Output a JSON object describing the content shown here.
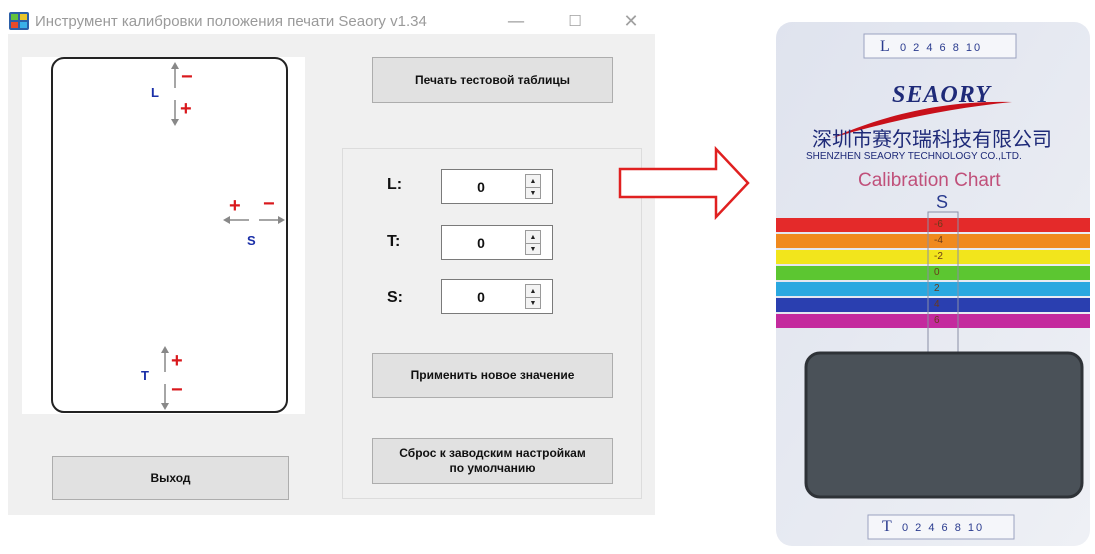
{
  "window": {
    "title": "Инструмент калибровки положения печати Seaory v1.34",
    "controls": {
      "minimize": "—",
      "maximize": "☐",
      "close": "✕"
    }
  },
  "diagram": {
    "label_l": "L",
    "label_s": "S",
    "label_t": "T",
    "plus": "+",
    "minus": "−",
    "accent_red": "#d9181c",
    "label_blue": "#1a2fa8"
  },
  "buttons": {
    "print_test": "Печать тестовой таблицы",
    "apply": "Применить новое значение",
    "reset_line1": "Сброс к заводским настройкам",
    "reset_line2": "по умолчанию",
    "exit": "Выход"
  },
  "fields": [
    {
      "label": "L:",
      "value": "0"
    },
    {
      "label": "T:",
      "value": "0"
    },
    {
      "label": "S:",
      "value": "0"
    }
  ],
  "card_photo": {
    "top_scale_letter": "L",
    "top_scale_numbers": "0 2 4 6 8 10",
    "brand": "SEAORY",
    "company_cn": "深圳市赛尔瑞科技有限公司",
    "company_en": "SHENZHEN SEAORY TECHNOLOGY CO.,LTD.",
    "chart_title": "Calibration Chart",
    "s_label": "S",
    "stripe_values": [
      "-6",
      "-4",
      "-2",
      "0",
      "2",
      "4",
      "6"
    ],
    "stripe_colors": [
      "#e42a2a",
      "#f08a1e",
      "#f2e51c",
      "#5cc631",
      "#2aa8e0",
      "#2a3fb0",
      "#c42a9e"
    ],
    "bottom_scale_letter": "T",
    "bottom_scale_numbers": "0 2 4 6 8 10"
  },
  "arrow": {
    "color": "#e02020"
  }
}
